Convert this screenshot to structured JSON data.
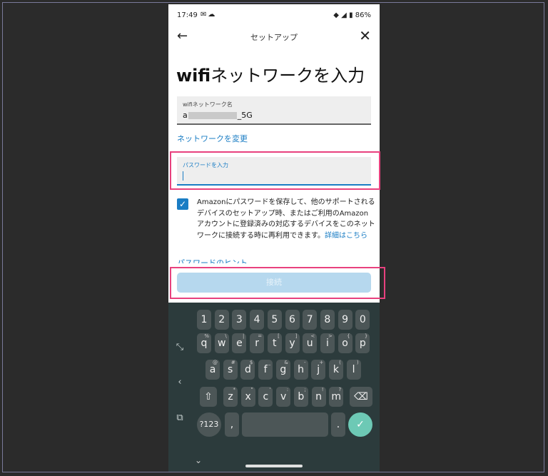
{
  "status_bar": {
    "time": "17:49",
    "notification_icons": [
      "mail-icon",
      "cloud-icon"
    ],
    "battery": "86%"
  },
  "app_bar": {
    "title": "セットアップ",
    "back_icon": "arrow-back-icon",
    "close_icon": "close-icon"
  },
  "heading": {
    "bold_part": "wifi",
    "rest": "ネットワークを入力"
  },
  "network_field": {
    "label": "wifiネットワーク名",
    "value_prefix": "a",
    "value_suffix": "_5G"
  },
  "change_network_link": "ネットワークを変更",
  "password_field": {
    "label": "パスワードを入力",
    "value": ""
  },
  "save_password": {
    "checked": true,
    "text": "Amazonにパスワードを保存して、他のサポートされるデバイスのセットアップ時、またはご利用のAmazonアカウントに登録済みの対応するデバイスをこのネットワークに接続する時に再利用できます。",
    "details_link": "詳細はこちら"
  },
  "password_hint_link": "パスワードのヒント",
  "connect_button": "接続",
  "colors": {
    "accent": "#1a7dc4",
    "highlight": "#e8417e",
    "keyboard_bg": "#2c3b3c",
    "key_bg": "#4c5657",
    "enter_key": "#6dc9b5"
  },
  "keyboard": {
    "number_row": [
      "1",
      "2",
      "3",
      "4",
      "5",
      "6",
      "7",
      "8",
      "9",
      "0"
    ],
    "row1": [
      {
        "k": "q",
        "s": "%"
      },
      {
        "k": "w",
        "s": "\\"
      },
      {
        "k": "e",
        "s": "|"
      },
      {
        "k": "r",
        "s": "="
      },
      {
        "k": "t",
        "s": "["
      },
      {
        "k": "y",
        "s": "]"
      },
      {
        "k": "u",
        "s": "<"
      },
      {
        "k": "i",
        "s": ">"
      },
      {
        "k": "o",
        "s": "{"
      },
      {
        "k": "p",
        "s": "}"
      }
    ],
    "row2": [
      {
        "k": "a",
        "s": "@"
      },
      {
        "k": "s",
        "s": "#"
      },
      {
        "k": "d",
        "s": "$"
      },
      {
        "k": "f",
        "s": "_"
      },
      {
        "k": "g",
        "s": "&"
      },
      {
        "k": "h",
        "s": "-"
      },
      {
        "k": "j",
        "s": "+"
      },
      {
        "k": "k",
        "s": "("
      },
      {
        "k": "l",
        "s": ")"
      }
    ],
    "row3": [
      {
        "k": "z",
        "s": "*"
      },
      {
        "k": "x",
        "s": "\""
      },
      {
        "k": "c",
        "s": "'"
      },
      {
        "k": "v",
        "s": ":"
      },
      {
        "k": "b",
        "s": ";"
      },
      {
        "k": "n",
        "s": "!"
      },
      {
        "k": "m",
        "s": "?"
      }
    ],
    "symbols_key": "?123",
    "comma_key": ",",
    "period_key": "."
  }
}
